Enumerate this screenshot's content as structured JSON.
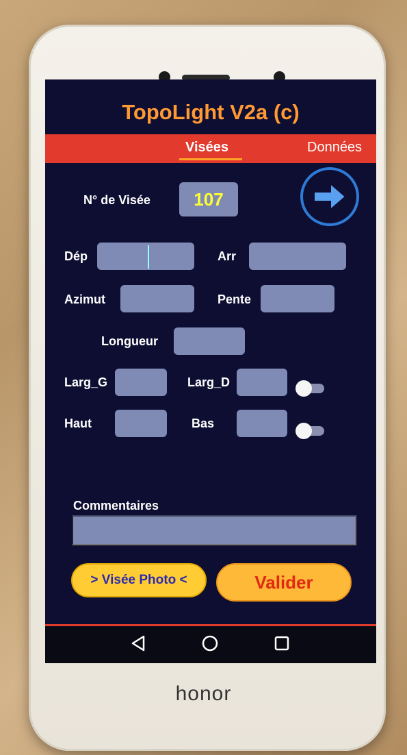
{
  "device": {
    "brand": "honor"
  },
  "app": {
    "title": "TopoLight  V2a (c)"
  },
  "tabs": [
    {
      "label": "Visées",
      "active": true
    },
    {
      "label": "Données",
      "active": false
    }
  ],
  "visee": {
    "label": "N° de Visée",
    "value": "107"
  },
  "fields": {
    "dep": {
      "label": "Dép",
      "value": ""
    },
    "arr": {
      "label": "Arr",
      "value": ""
    },
    "azimut": {
      "label": "Azimut",
      "value": ""
    },
    "pente": {
      "label": "Pente",
      "value": ""
    },
    "longueur": {
      "label": "Longueur",
      "value": ""
    },
    "larg_g": {
      "label": "Larg_G",
      "value": ""
    },
    "larg_d": {
      "label": "Larg_D",
      "value": ""
    },
    "haut": {
      "label": "Haut",
      "value": ""
    },
    "bas": {
      "label": "Bas",
      "value": ""
    },
    "commentaires": {
      "label": "Commentaires",
      "value": ""
    }
  },
  "toggles": {
    "larg": false,
    "haut_bas": false
  },
  "buttons": {
    "photo": "> Visée Photo <",
    "valider": "Valider"
  },
  "icons": {
    "next": "arrow-right-icon",
    "back": "back-triangle-icon",
    "home": "home-circle-icon",
    "recent": "recent-square-icon"
  },
  "colors": {
    "background": "#0e0e33",
    "title": "#ff9933",
    "tabbar": "#e23a2c",
    "field": "#7f8bb5",
    "visee_number": "#ffff33",
    "accent_button": "#ffcc33"
  }
}
